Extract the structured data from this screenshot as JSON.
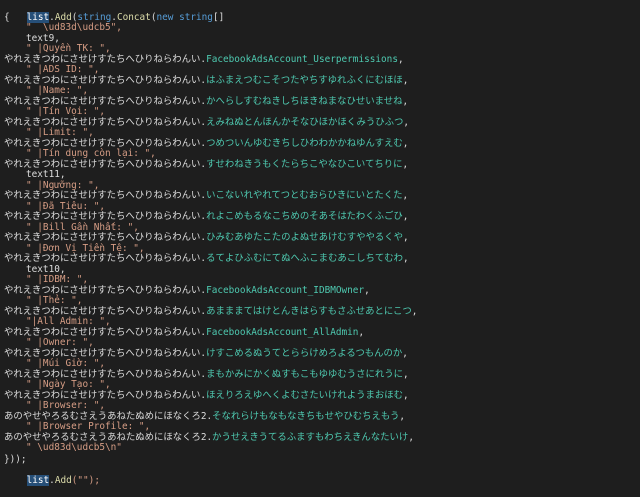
{
  "code": {
    "line0": {
      "var": "list",
      "dot": ".",
      "add": "Add",
      "paren": "(",
      "type": "string",
      "dot2": ".",
      "concat": "Concat",
      "paren2": "(",
      "new": "new",
      "space": " ",
      "string": "string",
      "brackets": "[]"
    },
    "line1": "{",
    "lines": [
      {
        "id": "l2",
        "indent": 1,
        "parts": [
          {
            "t": "\"  \\ud83d\\udcb5\",",
            "c": "str"
          }
        ]
      },
      {
        "id": "l3",
        "indent": 1,
        "parts": [
          {
            "t": "text9,",
            "c": "plain"
          }
        ]
      },
      {
        "id": "l4",
        "indent": 1,
        "parts": [
          {
            "t": "\" |Quyền TK: \",",
            "c": "str"
          }
        ]
      },
      {
        "id": "l5",
        "indent": 0,
        "parts": [
          {
            "t": "やれえきつわにさせけすたちへひりねらわんい.",
            "c": "plain"
          },
          {
            "t": "FacebookAdsAccount_Userpermissions",
            "c": "teal"
          },
          {
            "t": ",",
            "c": "plain"
          }
        ]
      },
      {
        "id": "l6",
        "indent": 1,
        "parts": [
          {
            "t": "\" |ADS ID: \",",
            "c": "str"
          }
        ]
      },
      {
        "id": "l7",
        "indent": 0,
        "parts": [
          {
            "t": "やれえきつわにさせけすたちへひりねらわんい.",
            "c": "plain"
          },
          {
            "t": "はふまえつむこそつたやちすゆれふくにむほほ",
            "c": "teal"
          },
          {
            "t": ",",
            "c": "plain"
          }
        ]
      },
      {
        "id": "l8",
        "indent": 1,
        "parts": [
          {
            "t": "\" |Name: \",",
            "c": "str"
          }
        ]
      },
      {
        "id": "l9",
        "indent": 0,
        "parts": [
          {
            "t": "やれえきつわにさせけすたちへひりねらわんい.",
            "c": "plain"
          },
          {
            "t": "かへらしすむねきしちほきねまなひせいませね",
            "c": "teal"
          },
          {
            "t": ",",
            "c": "plain"
          }
        ]
      },
      {
        "id": "l10",
        "indent": 1,
        "parts": [
          {
            "t": "\" |Tín Vọi: \",",
            "c": "str"
          }
        ]
      },
      {
        "id": "l11",
        "indent": 0,
        "parts": [
          {
            "t": "やれえきつわにさせけすたちへひりねらわんい.",
            "c": "plain"
          },
          {
            "t": "えみねぬとんほんかそなひほかほくみうひふつ",
            "c": "teal"
          },
          {
            "t": ",",
            "c": "plain"
          }
        ]
      },
      {
        "id": "l12",
        "indent": 1,
        "parts": [
          {
            "t": "\" |Limit: \",",
            "c": "str"
          }
        ]
      },
      {
        "id": "l13",
        "indent": 0,
        "parts": [
          {
            "t": "やれえきつわにさせけすたちへひりねらわんい.",
            "c": "plain"
          },
          {
            "t": "つめついんゆむきちしひわわかかねゆんすえむ",
            "c": "teal"
          },
          {
            "t": ",",
            "c": "plain"
          }
        ]
      },
      {
        "id": "l14",
        "indent": 1,
        "parts": [
          {
            "t": "\" |Tín dụng còn lại: \",",
            "c": "str"
          }
        ]
      },
      {
        "id": "l15",
        "indent": 0,
        "parts": [
          {
            "t": "やれえきつわにさせけすたちへひりねらわんい.",
            "c": "plain"
          },
          {
            "t": "すせわねきうもくたらちこやなひこいてちりに",
            "c": "teal"
          },
          {
            "t": ",",
            "c": "plain"
          }
        ]
      },
      {
        "id": "l16",
        "indent": 1,
        "parts": [
          {
            "t": "text11,",
            "c": "plain"
          }
        ]
      },
      {
        "id": "l17",
        "indent": 1,
        "parts": [
          {
            "t": "\" |Ngưỡng: \",",
            "c": "str"
          }
        ]
      },
      {
        "id": "l18",
        "indent": 0,
        "parts": [
          {
            "t": "やれえきつわにさせけすたちへひりねらわんい.",
            "c": "plain"
          },
          {
            "t": "いこないれやれてつとむおらひきにいとたくた",
            "c": "teal"
          },
          {
            "t": ",",
            "c": "plain"
          }
        ]
      },
      {
        "id": "l19",
        "indent": 1,
        "parts": [
          {
            "t": "\" |Đã Tiêu: \",",
            "c": "str"
          }
        ]
      },
      {
        "id": "l20",
        "indent": 0,
        "parts": [
          {
            "t": "やれえきつわにさせけすたちへひりねらわんい.",
            "c": "plain"
          },
          {
            "t": "れよこめもるなこちめのそあそはたわくふごひ",
            "c": "teal"
          },
          {
            "t": ",",
            "c": "plain"
          }
        ]
      },
      {
        "id": "l21",
        "indent": 1,
        "parts": [
          {
            "t": "\" |Bill Gần Nhất: \",",
            "c": "str"
          }
        ]
      },
      {
        "id": "l22",
        "indent": 0,
        "parts": [
          {
            "t": "やれえきつわにさせけすたちへひりねらわんい.",
            "c": "plain"
          },
          {
            "t": "ひみむあゆたこたのよぬせあけむすややるくや",
            "c": "teal"
          },
          {
            "t": ",",
            "c": "plain"
          }
        ]
      },
      {
        "id": "l23",
        "indent": 1,
        "parts": [
          {
            "t": "\" |Đơn Vị Tiền Tệ: \",",
            "c": "str"
          }
        ]
      },
      {
        "id": "l24",
        "indent": 0,
        "parts": [
          {
            "t": "やれえきつわにさせけすたちへひりねらわんい.",
            "c": "plain"
          },
          {
            "t": "るてよひふむにてぬへふこまむあこしちてむわ",
            "c": "teal"
          },
          {
            "t": ",",
            "c": "plain"
          }
        ]
      },
      {
        "id": "l25",
        "indent": 1,
        "parts": [
          {
            "t": "text10,",
            "c": "plain"
          }
        ]
      },
      {
        "id": "l26",
        "indent": 1,
        "parts": [
          {
            "t": "\" |IDBM: \",",
            "c": "str"
          }
        ]
      },
      {
        "id": "l27",
        "indent": 0,
        "parts": [
          {
            "t": "やれえきつわにさせけすたちへひりねらわんい.",
            "c": "plain"
          },
          {
            "t": "FacebookAdsAccount_IDBMOwner",
            "c": "teal"
          },
          {
            "t": ",",
            "c": "plain"
          }
        ]
      },
      {
        "id": "l28",
        "indent": 1,
        "parts": [
          {
            "t": "\" |Thẻ: \",",
            "c": "str"
          }
        ]
      },
      {
        "id": "l29",
        "indent": 0,
        "parts": [
          {
            "t": "やれえきつわにさせけすたちへひりねらわんい.",
            "c": "plain"
          },
          {
            "t": "あまままてはけとんきはらすもさふせあとにこつ",
            "c": "teal"
          },
          {
            "t": ",",
            "c": "plain"
          }
        ]
      },
      {
        "id": "l30",
        "indent": 1,
        "parts": [
          {
            "t": "\"|All Admin: \",",
            "c": "str"
          }
        ]
      },
      {
        "id": "l31",
        "indent": 0,
        "parts": [
          {
            "t": "やれえきつわにさせけすたちへひりねらわんい.",
            "c": "plain"
          },
          {
            "t": "FacebookAdsAccount_AllAdmin",
            "c": "teal"
          },
          {
            "t": ",",
            "c": "plain"
          }
        ]
      },
      {
        "id": "l32",
        "indent": 1,
        "parts": [
          {
            "t": "\" |Owner: \",",
            "c": "str"
          }
        ]
      },
      {
        "id": "l33",
        "indent": 0,
        "parts": [
          {
            "t": "やれえきつわにさせけすたちへひりねらわんい.",
            "c": "plain"
          },
          {
            "t": "けすこめるぬうてとららけめろよるつもんのか",
            "c": "teal"
          },
          {
            "t": ",",
            "c": "plain"
          }
        ]
      },
      {
        "id": "l34",
        "indent": 1,
        "parts": [
          {
            "t": "\" |Múi Giờ: \",",
            "c": "str"
          }
        ]
      },
      {
        "id": "l35",
        "indent": 0,
        "parts": [
          {
            "t": "やれえきつわにさせけすたちへひりねらわんい.",
            "c": "plain"
          },
          {
            "t": "まもかみにかくぬすもこもゆゆむうさにれうに",
            "c": "teal"
          },
          {
            "t": ",",
            "c": "plain"
          }
        ]
      },
      {
        "id": "l36",
        "indent": 1,
        "parts": [
          {
            "t": "\" |Ngày Tạo: \",",
            "c": "str"
          }
        ]
      },
      {
        "id": "l37",
        "indent": 0,
        "parts": [
          {
            "t": "やれえきつわにさせけすたちへひりねらわんい.",
            "c": "plain"
          },
          {
            "t": "ほえりろえゆへくよむさたいけれようまおほむ",
            "c": "teal"
          },
          {
            "t": ",",
            "c": "plain"
          }
        ]
      },
      {
        "id": "l38",
        "indent": 1,
        "parts": [
          {
            "t": "\" |Browser: \",",
            "c": "str"
          }
        ]
      },
      {
        "id": "l39",
        "indent": 0,
        "parts": [
          {
            "t": "あのやせやろるむさえうあねたぬめにほなくろ2.",
            "c": "plain"
          },
          {
            "t": "そなれらけもなもなきちもせやひむちえもう",
            "c": "teal"
          },
          {
            "t": ",",
            "c": "plain"
          }
        ]
      },
      {
        "id": "l40",
        "indent": 1,
        "parts": [
          {
            "t": "\" |Browser Profile: \",",
            "c": "str"
          }
        ]
      },
      {
        "id": "l41",
        "indent": 0,
        "parts": [
          {
            "t": "あのやせやろるむさえうあねたぬめにほなくろ2.",
            "c": "plain"
          },
          {
            "t": "かうせえきうてるふますもわちえきんなたいけ",
            "c": "teal"
          },
          {
            "t": ",",
            "c": "plain"
          }
        ]
      },
      {
        "id": "l42",
        "indent": 1,
        "parts": [
          {
            "t": "\" \\ud83d\\udcb5\\n\"",
            "c": "str"
          }
        ]
      }
    ],
    "line_close": "}));",
    "line_last": {
      "var": "list",
      "dot": ".",
      "add": "Add",
      "arg": "(\"\");"
    }
  }
}
